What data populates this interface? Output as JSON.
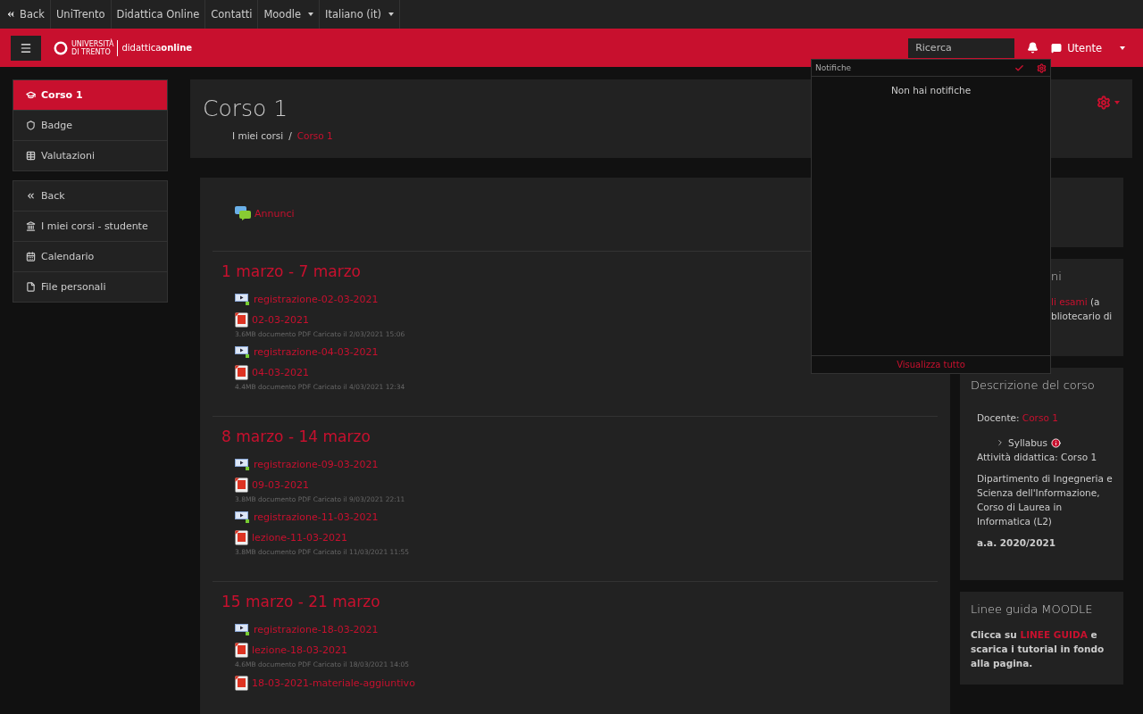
{
  "top_nav": [
    {
      "label": "Back",
      "kind": "back"
    },
    {
      "label": "UniTrento",
      "kind": "link"
    },
    {
      "label": "Didattica Online",
      "kind": "link"
    },
    {
      "label": "Contatti",
      "kind": "link"
    },
    {
      "label": "Moodle",
      "kind": "menu"
    },
    {
      "label": "Italiano (it)",
      "kind": "menu"
    }
  ],
  "header": {
    "logo_line1": "UNIVERSITÀ",
    "logo_line2": "DI TRENTO",
    "logo_brand": "didattica",
    "logo_brand_bold": "online",
    "search": {
      "placeholder": "Ricerca"
    },
    "user": "Utente"
  },
  "notifications": {
    "title": "Notifiche",
    "empty": "Non hai notifiche",
    "footer": "Visualizza tutto"
  },
  "sidebar": [
    [
      {
        "label": "Corso 1",
        "selected": true
      },
      {
        "label": "Badge",
        "selected": false
      },
      {
        "label": "Valutazioni",
        "selected": false
      }
    ],
    [
      {
        "label": "Back",
        "selected": false
      },
      {
        "label": "I miei corsi - studente",
        "selected": false
      },
      {
        "label": "Calendario",
        "selected": false
      },
      {
        "label": "File personali",
        "selected": false
      }
    ]
  ],
  "page_header": {
    "title": "Corso 1",
    "breadcrumb": [
      "I miei corsi",
      "Corso 1"
    ],
    "breadcrumb_separator": "/"
  },
  "sections": [
    {
      "items": [
        {
          "kind": "forum",
          "name": "Annunci"
        }
      ]
    },
    {
      "title": "1 marzo - 7 marzo",
      "items": [
        {
          "kind": "video",
          "name": "registrazione-02-03-2021"
        },
        {
          "kind": "pdf",
          "name": "02-03-2021",
          "meta": "3.6MB documento PDF Caricato il 2/03/2021 15:06"
        },
        {
          "kind": "video",
          "name": "registrazione-04-03-2021"
        },
        {
          "kind": "pdf",
          "name": "04-03-2021",
          "meta": "4.4MB documento PDF Caricato il 4/03/2021 12:34"
        }
      ]
    },
    {
      "title": "8 marzo - 14 marzo",
      "items": [
        {
          "kind": "video",
          "name": "registrazione-09-03-2021"
        },
        {
          "kind": "pdf",
          "name": "09-03-2021",
          "meta": "3.8MB documento PDF Caricato il 9/03/2021 22:11"
        },
        {
          "kind": "video",
          "name": "registrazione-11-03-2021"
        },
        {
          "kind": "pdf",
          "name": "lezione-11-03-2021",
          "meta": "3.8MB documento PDF Caricato il 11/03/2021 11:55"
        }
      ]
    },
    {
      "title": "15 marzo - 21 marzo",
      "items": [
        {
          "kind": "video",
          "name": "registrazione-18-03-2021"
        },
        {
          "kind": "pdf",
          "name": "lezione-18-03-2021",
          "meta": "4.6MB documento PDF Caricato il 18/03/2021 14:05"
        },
        {
          "kind": "pdf",
          "name": "18-03-2021-materiale-aggiuntivo"
        }
      ]
    }
  ],
  "blocks": [
    {
      "kind": "hidden"
    },
    {
      "kind": "partial",
      "title": "ni",
      "link": "li esami",
      "after": " (a",
      "line2": "bliotecario di"
    },
    {
      "kind": "description",
      "title": "Descrizione del corso",
      "docente_label": "Docente:",
      "docente": "Corso 1",
      "syllabus": "Syllabus",
      "activity": "Attività didattica: Corso 1",
      "department": "Dipartimento di Ingegneria e Scienza dell'Informazione, Corso di Laurea in Informatica (L2)",
      "year": "a.a. 2020/2021"
    },
    {
      "kind": "guide",
      "title": "Linee guida MOODLE",
      "before": "Clicca su ",
      "link": "LINEE GUIDA",
      "after": " e scarica i tutorial in fondo alla pagina."
    }
  ]
}
